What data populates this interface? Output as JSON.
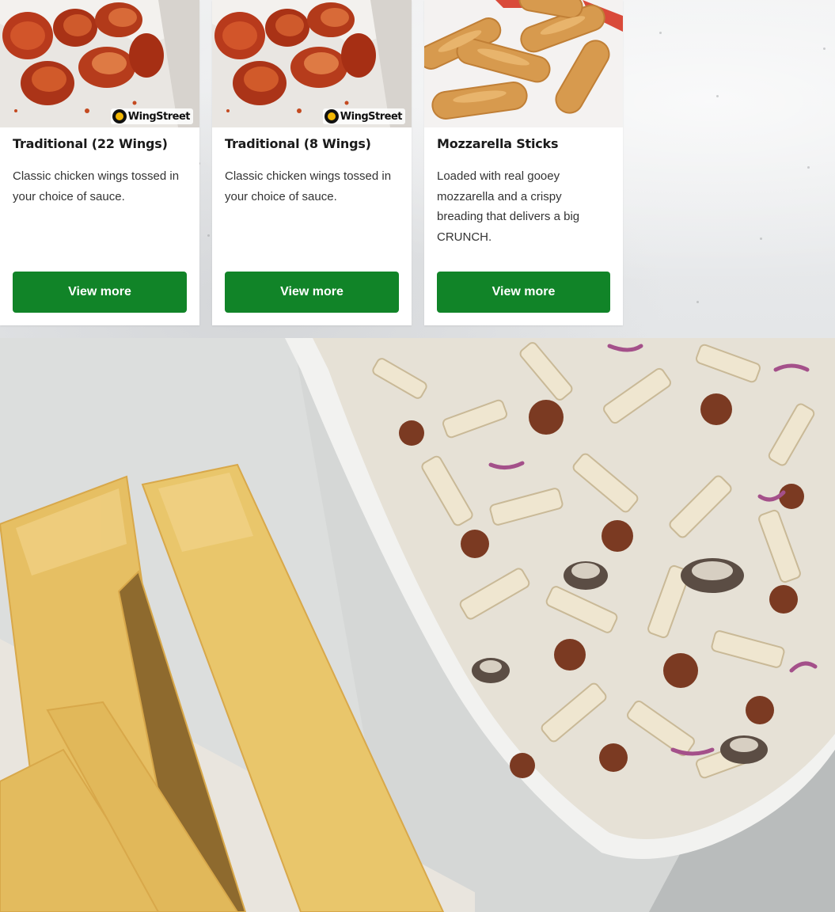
{
  "menu_cards": [
    {
      "title": "Traditional (22 Wings)",
      "description": "Classic chicken wings tossed in your choice of sauce.",
      "button_label": "View more",
      "image_icon": "chicken-wings-image",
      "brand_badge": "WingStreet"
    },
    {
      "title": "Traditional (8 Wings)",
      "description": "Classic chicken wings tossed in your choice of sauce.",
      "button_label": "View more",
      "image_icon": "chicken-wings-image",
      "brand_badge": "WingStreet"
    },
    {
      "title": "Mozzarella Sticks",
      "description": "Loaded with real gooey mozzarella and a crispy breading that delivers a big CRUNCH.",
      "button_label": "View more",
      "image_icon": "mozzarella-sticks-image"
    }
  ],
  "hero": {
    "image_icon": "pasta-and-breadsticks-image"
  },
  "colors": {
    "button_bg": "#118428",
    "button_text": "#ffffff",
    "title_text": "#1a1a1a",
    "body_text": "#333333"
  }
}
